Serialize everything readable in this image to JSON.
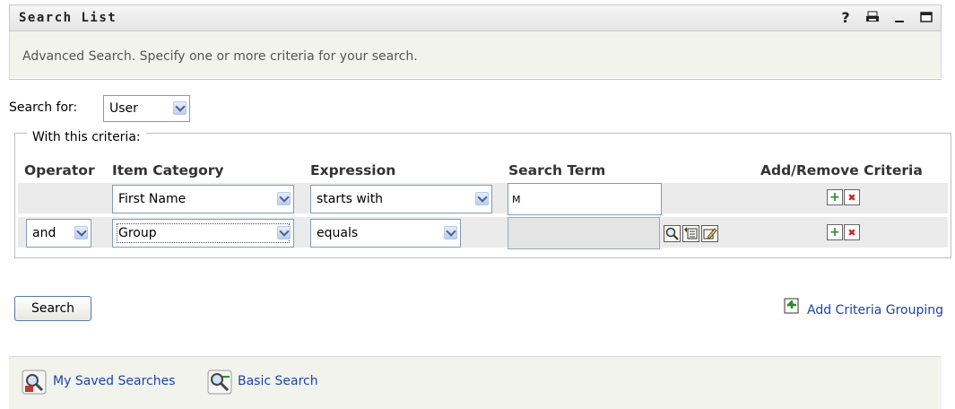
{
  "window": {
    "title": "Search List",
    "icons": {
      "help": "?",
      "print": "print-icon",
      "minimize": "_",
      "maximize": "maximize-icon"
    }
  },
  "description": "Advanced Search. Specify one or more criteria for your search.",
  "search_for": {
    "label": "Search for:",
    "value": "User"
  },
  "criteria": {
    "legend": "With this criteria:",
    "headers": {
      "operator": "Operator",
      "item_category": "Item Category",
      "expression": "Expression",
      "search_term": "Search Term",
      "add_remove": "Add/Remove Criteria"
    },
    "rows": [
      {
        "operator": "",
        "item_category": "First Name",
        "expression": "starts with",
        "search_term": "M"
      },
      {
        "operator": "and",
        "item_category": "Group",
        "expression": "equals",
        "search_term": ""
      }
    ],
    "add_symbol": "+",
    "remove_symbol": "✖"
  },
  "search_button": "Search",
  "add_grouping": "Add Criteria Grouping",
  "bottom": {
    "saved_searches": "My Saved Searches",
    "basic_search": "Basic Search"
  },
  "colors": {
    "link": "#1a44a8",
    "row_bg": "#ebebeb",
    "panel_bg": "#f3f3ee"
  }
}
